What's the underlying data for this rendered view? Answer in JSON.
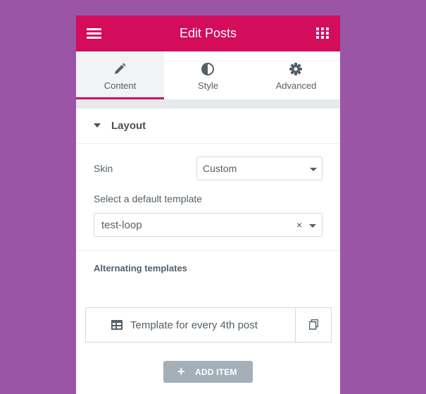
{
  "header": {
    "title": "Edit Posts",
    "menu_icon": "hamburger-icon",
    "grid_icon": "apps-grid-icon"
  },
  "tabs": [
    {
      "label": "Content",
      "icon": "pencil-icon",
      "active": true
    },
    {
      "label": "Style",
      "icon": "half-circle-icon",
      "active": false
    },
    {
      "label": "Advanced",
      "icon": "gear-icon",
      "active": false
    }
  ],
  "section": {
    "title": "Layout",
    "skin_label": "Skin",
    "skin_value": "Custom",
    "template_label": "Select a default template",
    "template_value": "test-loop",
    "clear_symbol": "×",
    "alternating_label": "Alternating templates"
  },
  "repeater": {
    "item_title": "Template for every 4th post"
  },
  "add_item": {
    "symbol": "+",
    "label": "ADD ITEM"
  },
  "colors": {
    "accent": "#d30c5c",
    "background": "#9b55a7",
    "button": "#a4afb7"
  }
}
